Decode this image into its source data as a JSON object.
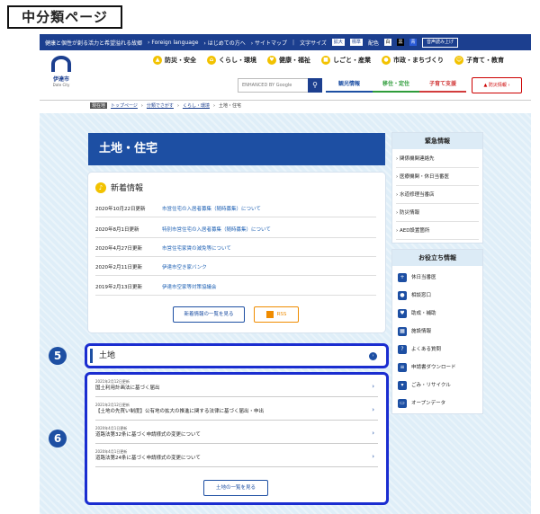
{
  "doc_label": "中分類ページ",
  "topbar": {
    "slogan": "健康と個性が創る活力と希望溢れる故郷",
    "links": [
      "Foreign language",
      "はじめての方へ",
      "サイトマップ"
    ],
    "font_label": "文字サイズ",
    "font_big": "拡大",
    "font_std": "標準",
    "color_label": "配色",
    "sw1": "白",
    "sw2": "黒",
    "sw3": "青",
    "voice": "音声読み上げ"
  },
  "header": {
    "city": "伊達市",
    "city_en": "Date City",
    "search_placeholder": "ENHANCED BY Google",
    "search_icon": "search-icon",
    "categories": [
      {
        "label": "防災・安全",
        "icon": "shield-icon",
        "color": "#f2c200"
      },
      {
        "label": "くらし・環境",
        "icon": "home-icon",
        "color": "#f2c200"
      },
      {
        "label": "健康・福祉",
        "icon": "heart-icon",
        "color": "#f2c200"
      },
      {
        "label": "しごと・産業",
        "icon": "briefcase-icon",
        "color": "#f2c200"
      },
      {
        "label": "市政・まちづくり",
        "icon": "building-icon",
        "color": "#f2c200"
      },
      {
        "label": "子育て・教育",
        "icon": "child-icon",
        "color": "#f2c200"
      }
    ],
    "subnav": [
      {
        "label": "観光情報",
        "color": "#1d4fa3"
      },
      {
        "label": "移住・定住",
        "color": "#2e9c3a"
      },
      {
        "label": "子育て支援",
        "color": "#d23c3c"
      }
    ],
    "bosai": "防災情報"
  },
  "breadcrumb": {
    "here": "現在地",
    "items": [
      "トップページ",
      "分類でさがす",
      "くらし・環境",
      "土地・住宅"
    ]
  },
  "page_title": "土地・住宅",
  "news": {
    "heading": "新着情報",
    "rows": [
      {
        "date": "2020年10月22日更新",
        "title": "市営住宅の入居者募集（随時募集）について"
      },
      {
        "date": "2020年8月1日更新",
        "title": "特別市営住宅の入居者募集（随時募集）について"
      },
      {
        "date": "2020年4月27日更新",
        "title": "市営住宅家賃の減免等について"
      },
      {
        "date": "2020年2月11日更新",
        "title": "伊達市空き家バンク"
      },
      {
        "date": "2019年2月13日更新",
        "title": "伊達市空家等対策協議会"
      }
    ],
    "more": "新着情報の一覧を見る",
    "rss": "RSS"
  },
  "emergency": {
    "heading": "緊急情報",
    "items": [
      "関係機関連絡先",
      "医療機関・休日当番医",
      "水道修理当番店",
      "防災情報",
      "AED設置箇所"
    ]
  },
  "useful": {
    "heading": "お役立ち情報",
    "items": [
      "休日当番医",
      "相談窓口",
      "助成・補助",
      "施設情報",
      "よくある質問",
      "申請書ダウンロード",
      "ごみ・リサイクル",
      "オープンデータ"
    ]
  },
  "marker5": "5",
  "marker6": "6",
  "section": {
    "title": "土地",
    "items": [
      {
        "date": "2021年2月12日更新",
        "title": "国土利用計画法に基づく届出"
      },
      {
        "date": "2021年2月12日更新",
        "title": "【土地の先買い制度】公有地の拡大の推進に関する法律に基づく届出・申出"
      },
      {
        "date": "2020年4月1日更新",
        "title": "道路法第32条に基づく申請様式の変更について"
      },
      {
        "date": "2020年4月1日更新",
        "title": "道路法第24条に基づく申請様式の変更について"
      }
    ],
    "more": "土地の一覧を見る"
  }
}
